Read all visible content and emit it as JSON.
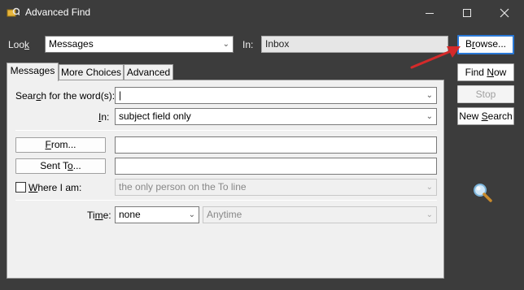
{
  "window": {
    "title": "Advanced Find",
    "controls": [
      "minimize-icon",
      "maximize-icon",
      "close-icon"
    ]
  },
  "look": {
    "label_pre": "Loo",
    "label_key": "k",
    "value": "Messages"
  },
  "in": {
    "label": "In:",
    "value": "Inbox"
  },
  "tabs": [
    {
      "label": "Messages"
    },
    {
      "label": "More Choices"
    },
    {
      "label": "Advanced"
    }
  ],
  "search": {
    "label_pre": "Sear",
    "label_key": "c",
    "label_post": "h for the word(s):",
    "value": "|"
  },
  "search_in": {
    "label_key": "I",
    "label_post": "n:",
    "value": "subject field only"
  },
  "from": {
    "label_key": "F",
    "label_post": "rom..."
  },
  "sent_to": {
    "label_pre": "Sent T",
    "label_key": "o",
    "label_post": "..."
  },
  "where": {
    "label_key": "W",
    "label_post": "here I am:",
    "value": "the only person on the To line"
  },
  "time": {
    "label_pre": "Ti",
    "label_key": "m",
    "label_post": "e:",
    "value": "none",
    "range": "Anytime"
  },
  "buttons": {
    "browse_pre": "B",
    "browse_key": "r",
    "browse_post": "owse...",
    "find_pre": "Find ",
    "find_key": "N",
    "find_post": "ow",
    "stop": "Stop",
    "new_search_pre": "New ",
    "new_search_key": "S",
    "new_search_post": "earch"
  },
  "colors": {
    "frame": "#3c3c3c",
    "panel": "#f0f0f0",
    "accent": "#2a78d6",
    "arrow": "#d42a2a"
  },
  "icons": [
    "app-icon",
    "magnifier-icon",
    "annotation-arrow-icon"
  ]
}
